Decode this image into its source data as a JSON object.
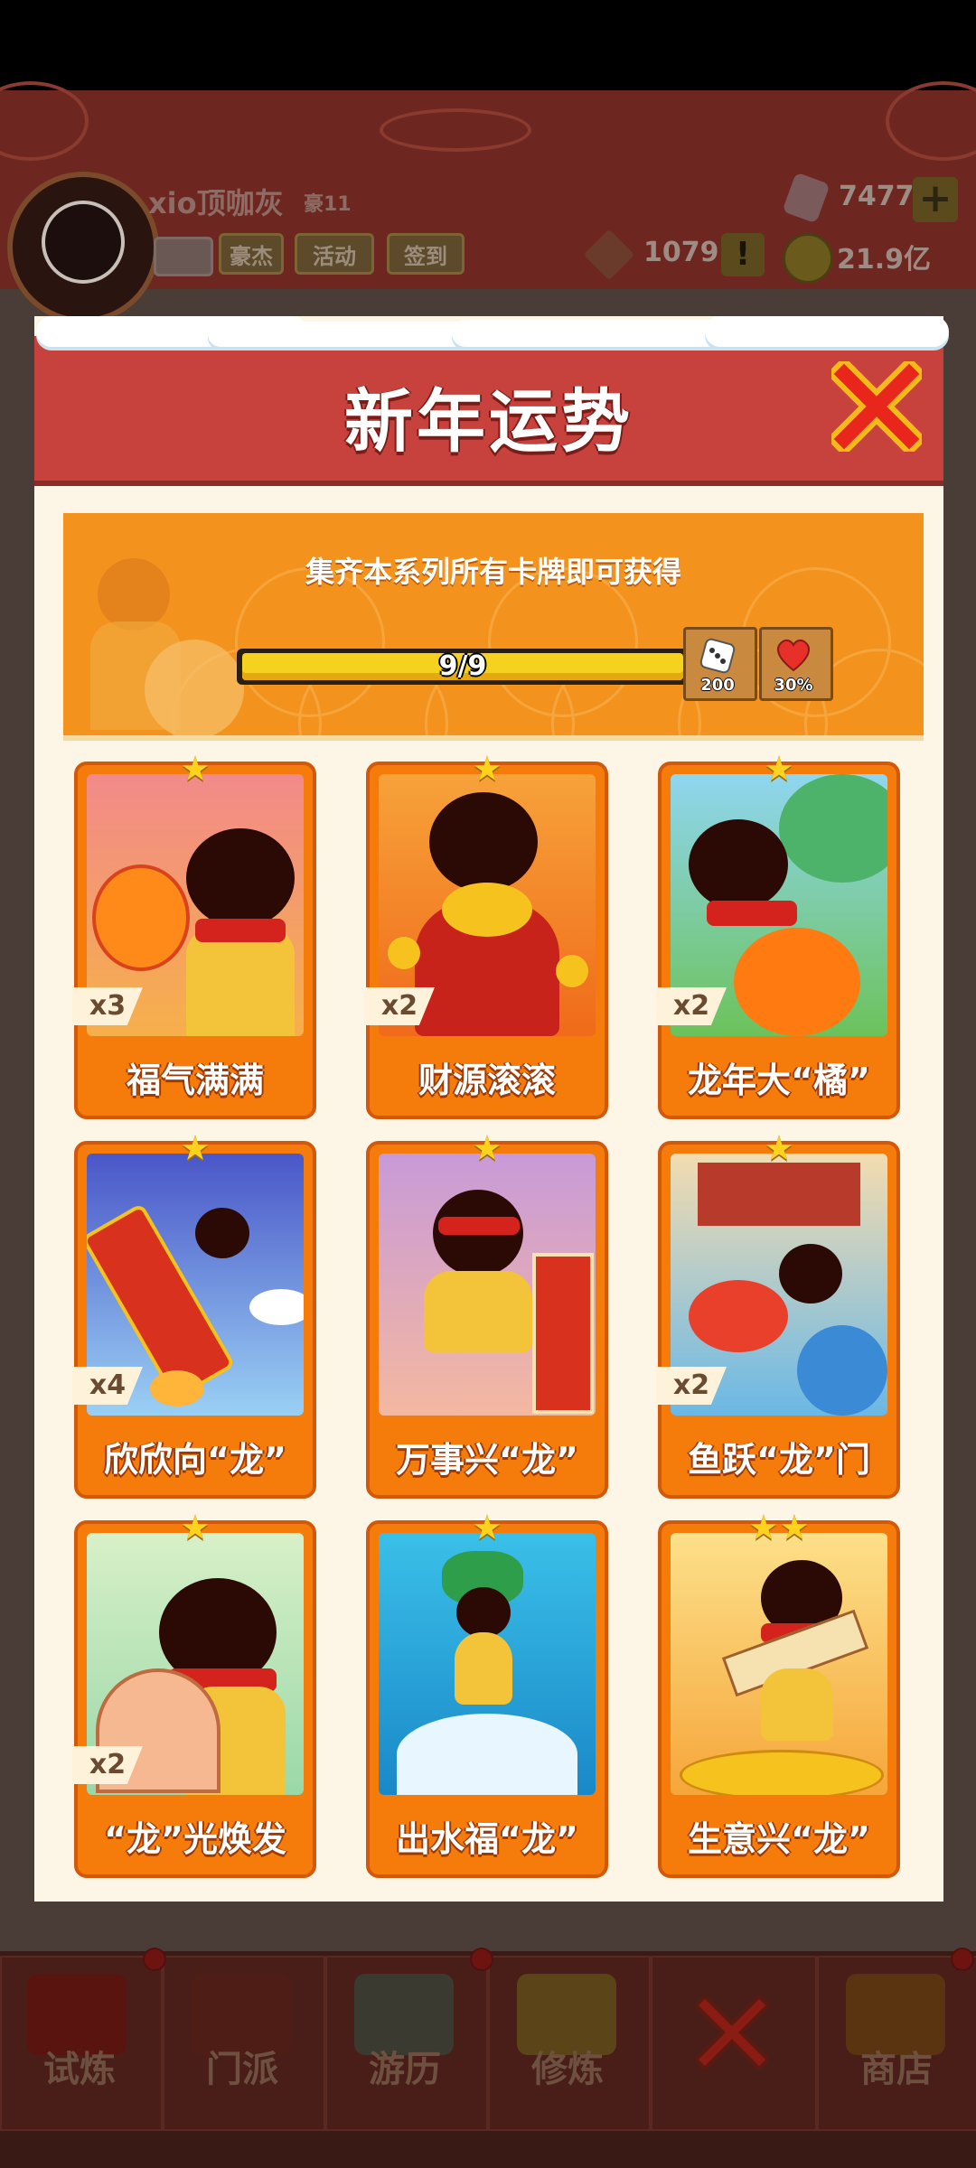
{
  "header": {
    "player_name": "xio顶咖灰",
    "rank": "豪11",
    "buttons": [
      "豪杰",
      "活动",
      "签到"
    ],
    "gems": "7477",
    "tokens": "1079",
    "coins": "21.9亿",
    "alert": "!",
    "plus": "+"
  },
  "modal": {
    "title": "新年运势",
    "banner_text": "集齐本系列所有卡牌即可获得",
    "progress_text": "9/9",
    "progress_fraction": 1.0,
    "rewards": [
      {
        "icon": "dice-icon",
        "value": "200"
      },
      {
        "icon": "heart-icon",
        "value": "30%"
      }
    ],
    "cards": [
      {
        "name": "福气满满",
        "count": "x3",
        "stars": "★",
        "theme": "lantern"
      },
      {
        "name": "财源滚滚",
        "count": "x2",
        "stars": "★",
        "theme": "gold"
      },
      {
        "name": "龙年大“橘”",
        "count": "x2",
        "stars": "★",
        "theme": "orange"
      },
      {
        "name": "欣欣向“龙”",
        "count": "x4",
        "stars": "★",
        "theme": "firework"
      },
      {
        "name": "万事兴“龙”",
        "count": "",
        "stars": "★",
        "theme": "scroll"
      },
      {
        "name": "鱼跃“龙”门",
        "count": "x2",
        "stars": "★",
        "theme": "carp"
      },
      {
        "name": "“龙”光焕发",
        "count": "x2",
        "stars": "★",
        "theme": "fan"
      },
      {
        "name": "出水福“龙”",
        "count": "",
        "stars": "★",
        "theme": "water"
      },
      {
        "name": "生意兴“龙”",
        "count": "",
        "stars": "★★",
        "theme": "coins"
      }
    ]
  },
  "bottom_nav": [
    "试炼",
    "门派",
    "游历",
    "修炼",
    "",
    "商店"
  ],
  "colors": {
    "accent_red": "#c8423d",
    "card_orange": "#f57c0b",
    "banner_orange": "#f3931e"
  }
}
